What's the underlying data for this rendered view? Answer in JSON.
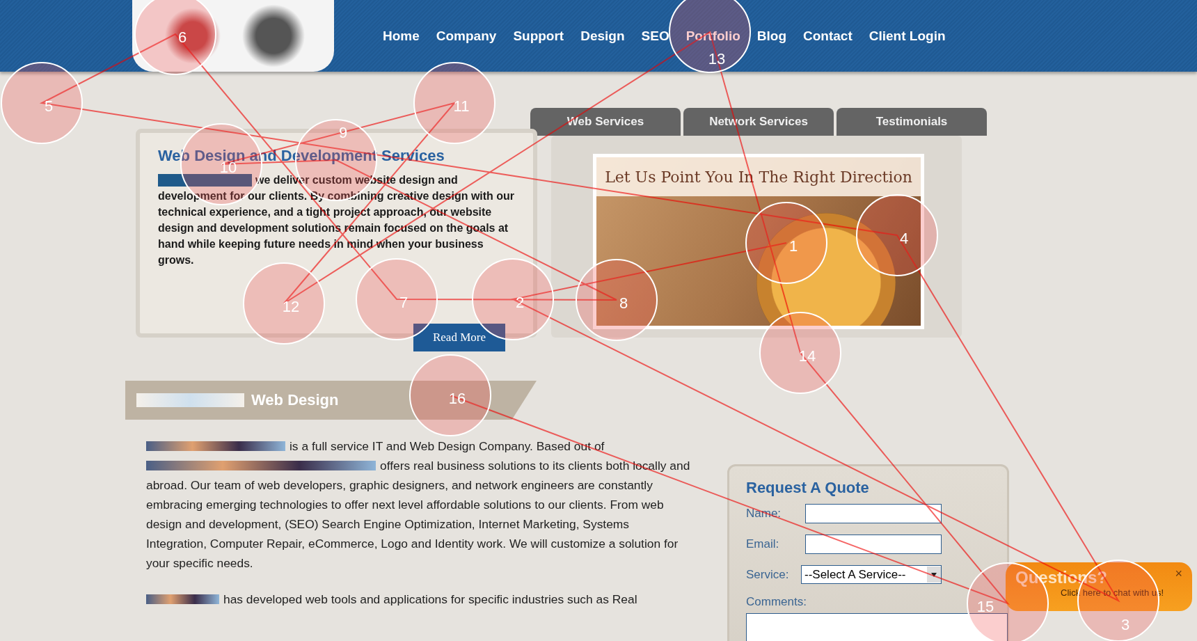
{
  "nav": [
    {
      "label": "Home"
    },
    {
      "label": "Company"
    },
    {
      "label": "Support"
    },
    {
      "label": "Design"
    },
    {
      "label": "SEO"
    },
    {
      "label": "Portfolio"
    },
    {
      "label": "Blog"
    },
    {
      "label": "Contact"
    },
    {
      "label": "Client Login"
    }
  ],
  "tabs": [
    {
      "label": "Web Services",
      "selected": false
    },
    {
      "label": "Network Services",
      "selected": false
    },
    {
      "label": "Testimonials",
      "selected": false
    }
  ],
  "intro": {
    "title": "Web Design and Development Services",
    "text": "we deliver custom website design and development for our clients. By combining creative design with our technical experience, and a tight project approach, our website design and development solutions remain focused on the goals at hand while keeping future needs in mind when your business grows.",
    "button": "Read More"
  },
  "banner": {
    "caption": "Let Us Point You In The Right Direction"
  },
  "section": {
    "title": "Web Design",
    "paragraphs": [
      {
        "segments": [
          "is a full service IT and Web Design Company. Based out of",
          "offers real business solutions to its clients both locally and abroad. Our team of web developers, graphic designers, and network engineers are constantly embracing emerging technologies to offer next level affordable solutions to our clients. From web design and development, (SEO) Search Engine Optimization, Internet Marketing, Systems Integration, Computer Repair, eCommerce, Logo and Identity work. We will customize a solution for your specific needs."
        ]
      },
      {
        "segments": [
          "has developed web tools and applications for specific industries such as Real"
        ]
      }
    ]
  },
  "quote": {
    "title": "Request A Quote",
    "fields": [
      {
        "kind": "text",
        "label": "Name:"
      },
      {
        "kind": "text",
        "label": "Email:"
      },
      {
        "kind": "select",
        "label": "Service:",
        "value": "--Select A Service--"
      },
      {
        "kind": "textarea",
        "label": "Comments:"
      }
    ]
  },
  "chat": {
    "title": "Questions?",
    "subtitle": "Click here to chat with us!",
    "close": "×"
  },
  "fixations": [
    "1",
    "2",
    "3",
    "4",
    "5",
    "6",
    "7",
    "8",
    "9",
    "10",
    "11",
    "12",
    "13",
    "14",
    "15",
    "16"
  ]
}
